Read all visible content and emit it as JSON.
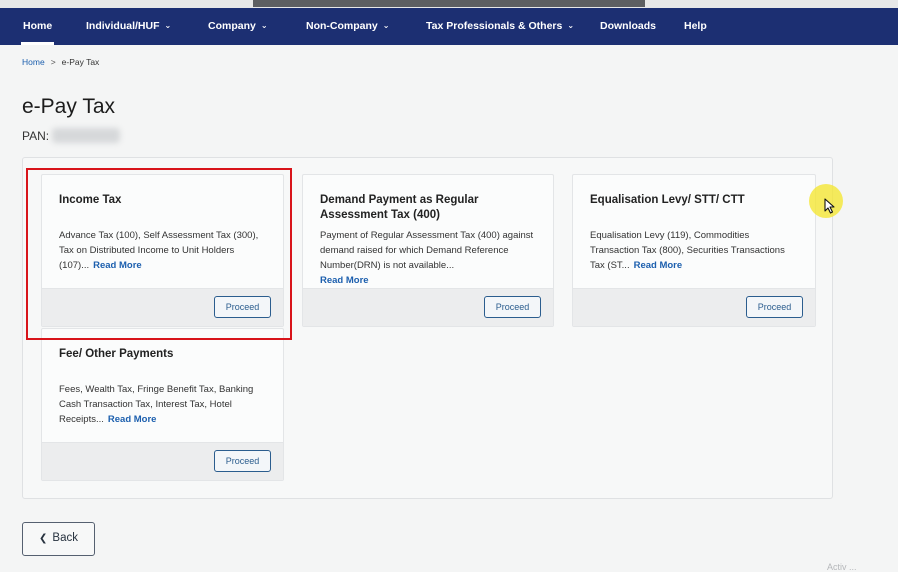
{
  "nav": {
    "home": "Home",
    "individual_huf": "Individual/HUF",
    "company": "Company",
    "non_company": "Non-Company",
    "tax_professionals": "Tax Professionals & Others",
    "downloads": "Downloads",
    "help": "Help",
    "active_item": "Home",
    "chevron_icon": "chevron-down-icon"
  },
  "breadcrumb": {
    "home": "Home",
    "separator": ">",
    "current": "e-Pay Tax"
  },
  "page": {
    "title": "e-Pay Tax",
    "pan_label": "PAN:"
  },
  "cards": [
    {
      "title": "Income Tax",
      "description": "Advance Tax (100), Self Assessment Tax (300), Tax on Distributed Income to Unit Holders (107)...",
      "read_more": "Read More",
      "button": "Proceed"
    },
    {
      "title": "Demand Payment as Regular Assessment Tax (400)",
      "description": "Payment of Regular Assessment Tax (400) against demand raised for which Demand Reference Number(DRN) is not available...",
      "read_more": "Read More",
      "button": "Proceed"
    },
    {
      "title": "Equalisation Levy/ STT/ CTT",
      "description": "Equalisation Levy (119), Commodities Transaction Tax (800), Securities Transactions Tax (ST...",
      "read_more": "Read More",
      "button": "Proceed"
    },
    {
      "title": "Fee/ Other Payments",
      "description": "Fees, Wealth Tax, Fringe Benefit Tax, Banking Cash Transaction Tax, Interest Tax, Hotel Receipts...",
      "read_more": "Read More",
      "button": "Proceed"
    }
  ],
  "back_button": {
    "label": "Back",
    "icon": "chevron-left-icon"
  },
  "watermark": "Activ ...",
  "colors": {
    "navbar": "#1c2f72",
    "link": "#1c5fae",
    "highlight": "#d8141a",
    "cursor_highlight": "#f4e628"
  }
}
